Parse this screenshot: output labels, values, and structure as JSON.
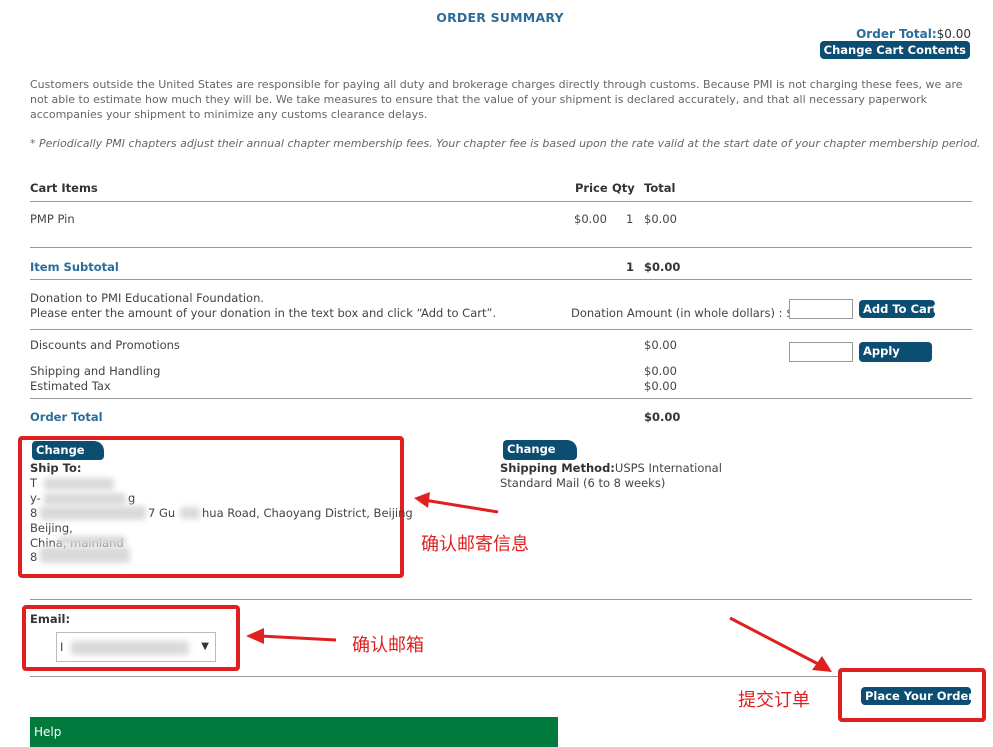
{
  "header": {
    "title": "ORDER SUMMARY",
    "order_total_label": "Order Total:",
    "order_total_value": "$0.00",
    "change_cart_label": "Change Cart Contents"
  },
  "notice": {
    "customs_text": "Customers outside the United States are responsible for paying all duty and brokerage charges directly through customs. Because PMI is not charging these fees, we are not able to estimate how much they will be. We take measures to ensure that the value of your shipment is declared accurately, and that all necessary paperwork accompanies your shipment to minimize any customs clearance delays.",
    "chapter_note": "* Periodically PMI chapters adjust their annual chapter membership fees. Your chapter fee is based upon the rate valid at the start date of your chapter membership period."
  },
  "cart": {
    "columns": {
      "items": "Cart Items",
      "price": "Price",
      "qty": "Qty",
      "total": "Total"
    },
    "rows": [
      {
        "name": "PMP Pin",
        "price": "$0.00",
        "qty": "1",
        "total": "$0.00"
      }
    ],
    "subtotal_label": "Item Subtotal",
    "subtotal_qty": "1",
    "subtotal_total": "$0.00"
  },
  "donation": {
    "line1": "Donation to PMI Educational Foundation.",
    "line2": "Please enter the amount of your donation in the text box and click “Add to Cart”.",
    "amount_label": "Donation Amount (in whole dollars) : $",
    "add_button": "Add To Cart"
  },
  "discounts": {
    "label": "Discounts and Promotions",
    "value": "$0.00",
    "apply_button": "Apply"
  },
  "shipping": {
    "label": "Shipping and Handling",
    "value": "$0.00",
    "tax_label": "Estimated Tax",
    "tax_value": "$0.00"
  },
  "order_total": {
    "label": "Order Total",
    "value": "$0.00"
  },
  "ship_to": {
    "change_button": "Change",
    "label": "Ship To:",
    "line1": "T",
    "line2": "y-",
    "line2_tail": "g",
    "line3_prefix": "8",
    "line3_mid": "7 Gu",
    "line3_tail": "hua Road, Chaoyang District, Beijing",
    "line4": "Beijing,",
    "line5": "China, mainland",
    "line6": "8"
  },
  "shipping_method": {
    "change_button": "Change",
    "label": "Shipping Method:",
    "value": "USPS International",
    "value2": "Standard Mail (6 to 8 weeks)"
  },
  "email": {
    "label": "Email:",
    "value_prefix": "I",
    "arrow": "▼"
  },
  "annotations": {
    "confirm_address": "确认邮寄信息",
    "confirm_email": "确认邮箱",
    "submit_order": "提交订单"
  },
  "place_order_button": "Place Your Order",
  "help_label": "Help",
  "colors": {
    "accent": "#2b6d98",
    "button": "#0c4d72",
    "annotation": "#e02020",
    "help_bar": "#007a3d"
  }
}
